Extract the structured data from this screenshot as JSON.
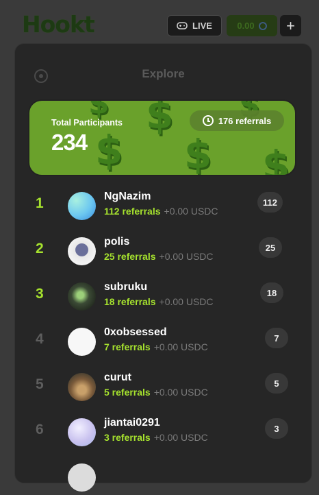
{
  "header": {
    "logo": "Hookt",
    "live_label": "LIVE",
    "balance": "0.00",
    "plus_label": "+"
  },
  "panel": {
    "title": "Explore"
  },
  "summary": {
    "label": "Total Participants",
    "value": "234",
    "referrals": "176 referrals"
  },
  "leaderboard": [
    {
      "rank": "1",
      "name": "NgNazim",
      "referrals": "112 referrals",
      "earned": "+0.00 USDC",
      "count": "112"
    },
    {
      "rank": "2",
      "name": "polis",
      "referrals": "25 referrals",
      "earned": "+0.00 USDC",
      "count": "25"
    },
    {
      "rank": "3",
      "name": "subruku",
      "referrals": "18 referrals",
      "earned": "+0.00 USDC",
      "count": "18"
    },
    {
      "rank": "4",
      "name": "0xobsessed",
      "referrals": "7 referrals",
      "earned": "+0.00 USDC",
      "count": "7"
    },
    {
      "rank": "5",
      "name": "curut",
      "referrals": "5 referrals",
      "earned": "+0.00 USDC",
      "count": "5"
    },
    {
      "rank": "6",
      "name": "jiantai0291",
      "referrals": "3 referrals",
      "earned": "+0.00 USDC",
      "count": "3"
    }
  ],
  "colors": {
    "accent": "#a6e22e",
    "card": "#6aa12b",
    "panel": "#262626"
  }
}
